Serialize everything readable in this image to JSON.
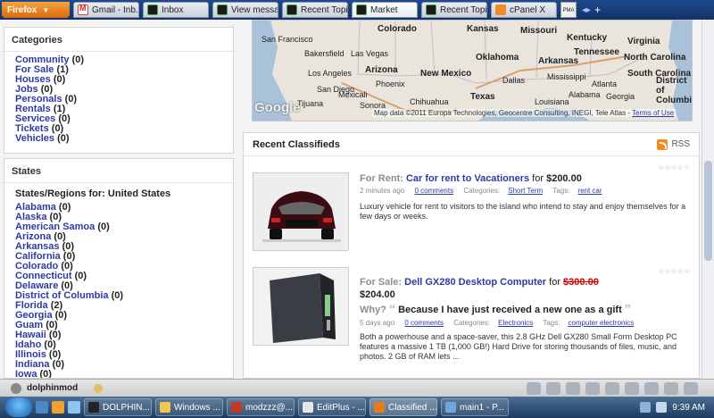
{
  "browser": {
    "menu_label": "Firefox",
    "tabs": [
      {
        "label": "Gmail - Inb...",
        "icon": "gmail-icon"
      },
      {
        "label": "Inbox",
        "icon": "dolphin-icon"
      },
      {
        "label": "View messa...",
        "icon": "dolphin-icon"
      },
      {
        "label": "Recent Topi...",
        "icon": "dolphin-icon"
      },
      {
        "label": "Market",
        "icon": "dolphin-icon"
      },
      {
        "label": "Recent Topi...",
        "icon": "dolphin-icon"
      },
      {
        "label": "cPanel X",
        "icon": "cpanel-icon"
      }
    ],
    "pma_label": "PMA"
  },
  "categories": {
    "title": "Categories",
    "items": [
      {
        "label": "Community",
        "count": "(0)"
      },
      {
        "label": "For Sale",
        "count": "(1)"
      },
      {
        "label": "Houses",
        "count": "(0)"
      },
      {
        "label": "Jobs",
        "count": "(0)"
      },
      {
        "label": "Personals",
        "count": "(0)"
      },
      {
        "label": "Rentals",
        "count": "(1)"
      },
      {
        "label": "Services",
        "count": "(0)"
      },
      {
        "label": "Tickets",
        "count": "(0)"
      },
      {
        "label": "Vehicles",
        "count": "(0)"
      }
    ]
  },
  "states": {
    "title": "States",
    "subtitle": "States/Regions for: United States",
    "items": [
      {
        "label": "Alabama",
        "count": "(0)"
      },
      {
        "label": "Alaska",
        "count": "(0)"
      },
      {
        "label": "American Samoa",
        "count": "(0)"
      },
      {
        "label": "Arizona",
        "count": "(0)"
      },
      {
        "label": "Arkansas",
        "count": "(0)"
      },
      {
        "label": "California",
        "count": "(0)"
      },
      {
        "label": "Colorado",
        "count": "(0)"
      },
      {
        "label": "Connecticut",
        "count": "(0)"
      },
      {
        "label": "Delaware",
        "count": "(0)"
      },
      {
        "label": "District of Columbia",
        "count": "(0)"
      },
      {
        "label": "Florida",
        "count": "(2)"
      },
      {
        "label": "Georgia",
        "count": "(0)"
      },
      {
        "label": "Guam",
        "count": "(0)"
      },
      {
        "label": "Hawaii",
        "count": "(0)"
      },
      {
        "label": "Idaho",
        "count": "(0)"
      },
      {
        "label": "Illinois",
        "count": "(0)"
      },
      {
        "label": "Indiana",
        "count": "(0)"
      },
      {
        "label": "Iowa",
        "count": "(0)"
      }
    ]
  },
  "map": {
    "logo": "Google",
    "credit": "Map data ©2011 Europa Technologies, Geocentre Consulting, INEGI, Tele Atlas -",
    "terms": "Terms of Use",
    "labels": {
      "san_francisco": "San Francisco",
      "colorado": "Colorado",
      "kansas": "Kansas",
      "missouri": "Missouri",
      "kentucky": "Kentucky",
      "virginia": "Virginia",
      "bakersfield": "Bakersfield",
      "las_vegas": "Las Vegas",
      "arizona": "Arizona",
      "new_mexico": "New Mexico",
      "oklahoma": "Oklahoma",
      "arkansas": "Arkansas",
      "tennessee": "Tennessee",
      "north_carolina": "North Carolina",
      "south_carolina": "South Carolina",
      "district_of_columbia": "District of Columbia",
      "los_angeles": "Los Angeles",
      "san_diego": "San Diego",
      "phoenix": "Phoenix",
      "dallas": "Dallas",
      "texas": "Texas",
      "atlanta": "Atlanta",
      "mississippi": "Mississippi",
      "alabama": "Alabama",
      "georgia": "Georgia",
      "chihuahua": "Chihuahua",
      "sonora": "Sonora",
      "louisiana": "Louisiana",
      "mexicali": "Mexicali",
      "tijuana": "Tijuana"
    }
  },
  "classifieds": {
    "title": "Recent Classifieds",
    "rss_label": "RSS",
    "listings": [
      {
        "label": "For Rent:",
        "title": "Car for rent to Vacationers",
        "for_word": "for",
        "price": "$200.00",
        "time": "2 minutes ago",
        "comments": "0 comments",
        "categories_label": "Categories:",
        "category": "Short Term",
        "tags_label": "Tags:",
        "tags": "rent car",
        "description": "Luxury vehicle for rent to visitors to the island who intend to stay and enjoy themselves for a few days or weeks."
      },
      {
        "label": "For Sale:",
        "title": "Dell GX280 Desktop Computer",
        "for_word": "for",
        "old_price": "$300.00",
        "price": "$204.00",
        "why_label": "Why?",
        "reason": "Because I have just received a new one as a gift",
        "time": "5 days ago",
        "comments": "0 comments",
        "categories_label": "Categories:",
        "category": "Electronics",
        "tags_label": "Tags:",
        "tags": "computer electronics",
        "description": "Both a powerhouse and a space-saver, this 2.8 GHz Dell GX280 Small Form Desktop PC features a massive 1 TB (1,000 GB!) Hard Drive for storing thousands of files, music, and photos. 2 GB of RAM lets ..."
      }
    ]
  },
  "status_bar": {
    "user": "dolphinmod"
  },
  "taskbar": {
    "buttons": [
      {
        "label": "DOLPHIN..."
      },
      {
        "label": "Windows ..."
      },
      {
        "label": "modzzz@..."
      },
      {
        "label": "EditPlus - ..."
      },
      {
        "label": "Classified ..."
      },
      {
        "label": "main1 - P..."
      }
    ],
    "clock": "9:39 AM"
  },
  "colors": {
    "link": "#2d3aa2",
    "price_old": "#cc0000",
    "accent_orange": "#f48a20"
  }
}
